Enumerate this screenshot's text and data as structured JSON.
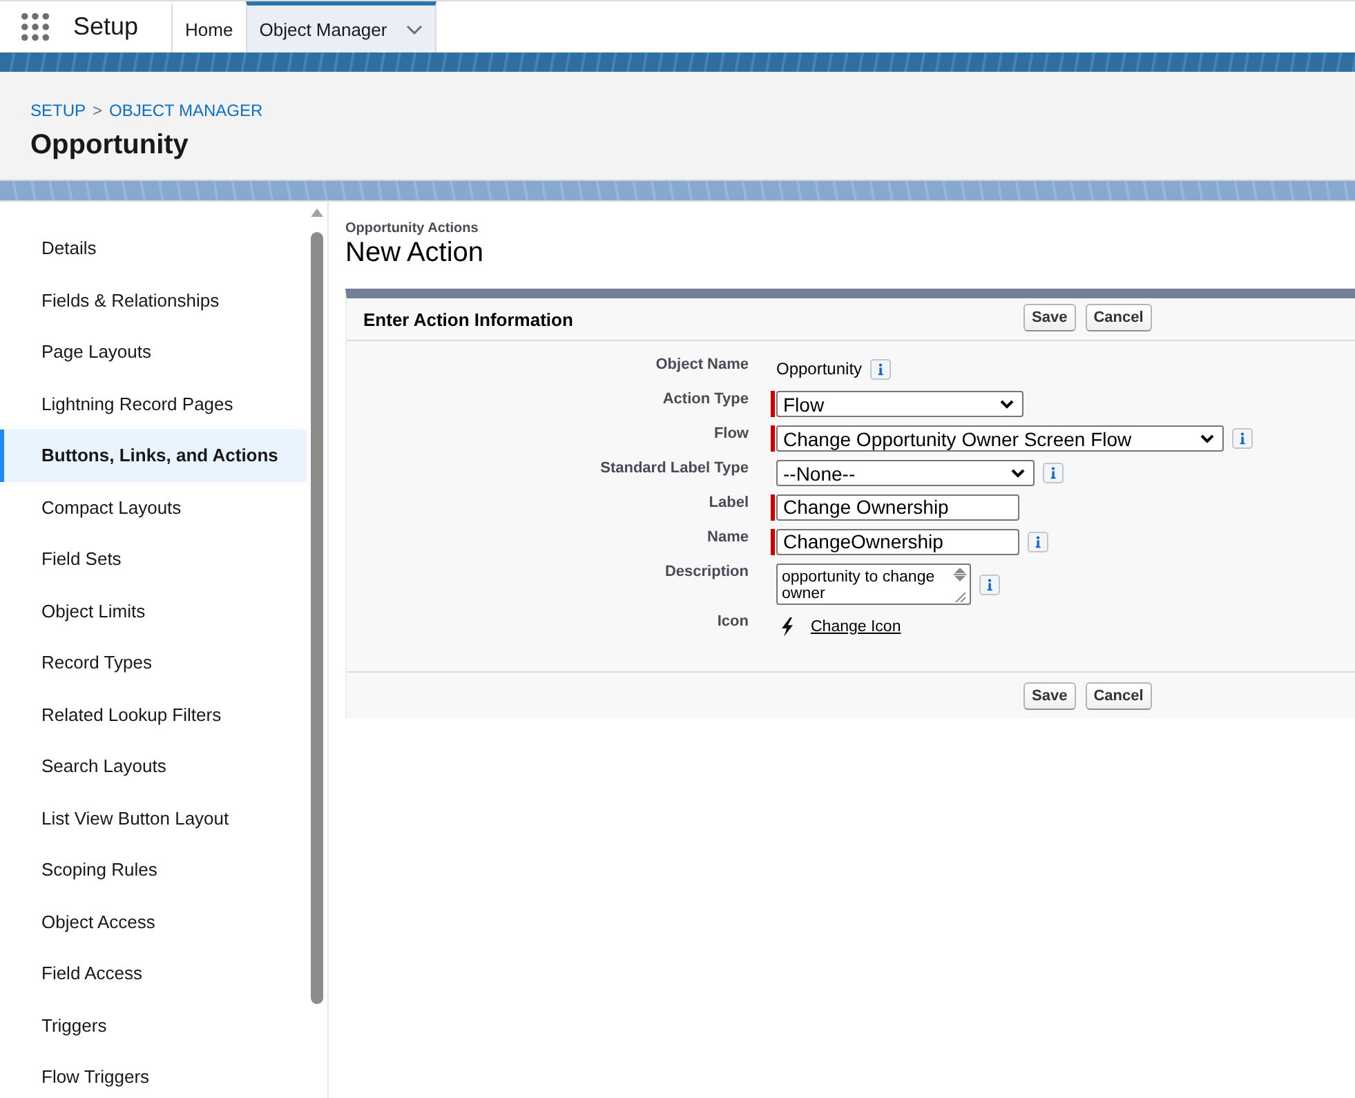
{
  "nav": {
    "app_name": "Setup",
    "tabs": [
      {
        "label": "Home",
        "selected": false,
        "has_menu": false
      },
      {
        "label": "Object Manager",
        "selected": true,
        "has_menu": true
      }
    ]
  },
  "header": {
    "breadcrumb": [
      "SETUP",
      "OBJECT MANAGER"
    ],
    "separator": ">",
    "title": "Opportunity"
  },
  "sidebar": {
    "items": [
      {
        "label": "Details",
        "selected": false
      },
      {
        "label": "Fields & Relationships",
        "selected": false
      },
      {
        "label": "Page Layouts",
        "selected": false
      },
      {
        "label": "Lightning Record Pages",
        "selected": false
      },
      {
        "label": "Buttons, Links, and Actions",
        "selected": true
      },
      {
        "label": "Compact Layouts",
        "selected": false
      },
      {
        "label": "Field Sets",
        "selected": false
      },
      {
        "label": "Object Limits",
        "selected": false
      },
      {
        "label": "Record Types",
        "selected": false
      },
      {
        "label": "Related Lookup Filters",
        "selected": false
      },
      {
        "label": "Search Layouts",
        "selected": false
      },
      {
        "label": "List View Button Layout",
        "selected": false
      },
      {
        "label": "Scoping Rules",
        "selected": false
      },
      {
        "label": "Object Access",
        "selected": false
      },
      {
        "label": "Field Access",
        "selected": false
      },
      {
        "label": "Triggers",
        "selected": false
      },
      {
        "label": "Flow Triggers",
        "selected": false
      }
    ]
  },
  "page": {
    "subtitle": "Opportunity Actions",
    "title": "New Action"
  },
  "form": {
    "title": "Enter Action Information",
    "buttons": [
      "Save",
      "Cancel"
    ],
    "fields": [
      {
        "kind": "text",
        "label": "Object Name",
        "value": "Opportunity",
        "required": false,
        "info": true
      },
      {
        "kind": "select",
        "label": "Action Type",
        "value": "Flow",
        "required": true,
        "info": false
      },
      {
        "kind": "select",
        "label": "Flow",
        "value": "Change Opportunity Owner Screen Flow",
        "required": true,
        "info": true
      },
      {
        "kind": "select",
        "label": "Standard Label Type",
        "value": "--None--",
        "required": false,
        "info": true
      },
      {
        "kind": "input",
        "label": "Label",
        "value": "Change Ownership",
        "required": true,
        "info": false
      },
      {
        "kind": "input",
        "label": "Name",
        "value": "ChangeOwnership",
        "required": true,
        "info": true
      },
      {
        "kind": "textarea",
        "label": "Description",
        "value": "opportunity to change owner",
        "required": false,
        "info": true
      },
      {
        "kind": "icon",
        "label": "Icon",
        "value": "Change Icon",
        "required": false,
        "info": false
      }
    ],
    "bottom_buttons": [
      "Save",
      "Cancel"
    ]
  }
}
